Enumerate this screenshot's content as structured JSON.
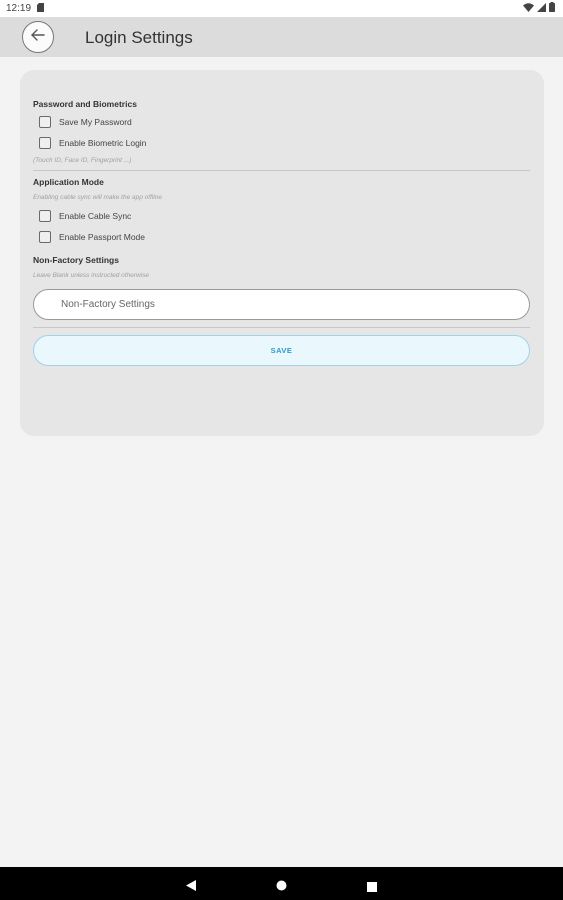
{
  "status_bar": {
    "time": "12:19"
  },
  "header": {
    "title": "Login Settings"
  },
  "password_section": {
    "title": "Password and Biometrics",
    "save_password_label": "Save My Password",
    "biometric_label": "Enable Biometric Login",
    "biometric_hint": "(Touch ID, Face ID, Fingerprint ...)"
  },
  "application_mode": {
    "title": "Application Mode",
    "hint": "Enabling cable sync will make the app offline",
    "cable_sync_label": "Enable Cable Sync",
    "passport_label": "Enable Passport Mode"
  },
  "non_factory": {
    "title": "Non-Factory Settings",
    "hint": "Leave Blank unless instructed otherwise",
    "placeholder": "Non-Factory Settings",
    "value": ""
  },
  "save_label": "SAVE",
  "colors": {
    "header_bg": "#dcdcdc",
    "card_bg": "#e6e6e6",
    "accent": "#2a9bc9",
    "save_bg": "#eaf8fd"
  }
}
